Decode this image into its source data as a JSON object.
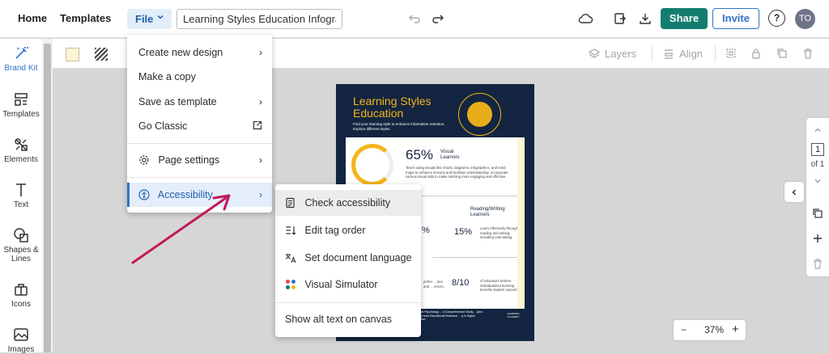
{
  "header": {
    "home": "Home",
    "templates": "Templates",
    "file": "File",
    "document_title": "Learning Styles Education Infogra...",
    "share": "Share",
    "invite": "Invite",
    "help": "?",
    "avatar_initials": "TO"
  },
  "toolbar": {
    "layers": "Layers",
    "align": "Align"
  },
  "sidebar": {
    "items": [
      {
        "label": "Brand Kit",
        "icon": "wand-icon"
      },
      {
        "label": "Templates",
        "icon": "templates-icon"
      },
      {
        "label": "Elements",
        "icon": "elements-icon"
      },
      {
        "label": "Text",
        "icon": "text-icon"
      },
      {
        "label": "Shapes & Lines",
        "icon": "shapes-icon"
      },
      {
        "label": "Icons",
        "icon": "icons-icon"
      },
      {
        "label": "Images",
        "icon": "images-icon"
      }
    ]
  },
  "file_menu": {
    "items": [
      {
        "label": "Create new design",
        "has_submenu": true
      },
      {
        "label": "Make a copy",
        "has_submenu": false
      },
      {
        "label": "Save as template",
        "has_submenu": true
      },
      {
        "label": "Go Classic",
        "has_submenu": false
      },
      {
        "label": "Page settings",
        "has_submenu": true
      },
      {
        "label": "Accessibility",
        "has_submenu": true
      }
    ]
  },
  "accessibility_menu": {
    "items": [
      {
        "label": "Check accessibility",
        "icon": "checklist-icon"
      },
      {
        "label": "Edit tag order",
        "icon": "tag-order-icon"
      },
      {
        "label": "Set document language",
        "icon": "translate-icon"
      },
      {
        "label": "Visual Simulator",
        "icon": "dots-icon"
      },
      {
        "label": "Show alt text on canvas",
        "icon": ""
      }
    ]
  },
  "pages": {
    "current": "1",
    "total_label": "of 1"
  },
  "zoom": {
    "minus": "−",
    "value": "37%",
    "plus": "+"
  },
  "document": {
    "title": "Learning Styles Education",
    "subtitle": "Find your learning style to enhance information retention. Explore different styles.",
    "stat1_value": "65%",
    "stat1_label": "Visual Learners",
    "stat1_text": "Teach using visuals like charts, diagrams, infographics, and mind maps to enhance lessons and facilitate understanding. Incorporate various visual aids to make learning more engaging and effective.",
    "stat2_value": "%",
    "stat3_value": "15%",
    "stat3_label": "Reading/Writing Learners",
    "stat3_text": "Learn effectively through reading and writing, including note-taking.",
    "stat4_prefix_text": "prefer ... tles and ... ences.",
    "stat5_value": "8/10",
    "stat5_text": "of educators believe individualized learning benefits student outcomes.",
    "footer_text": "...ational Psychology ... A Comprehensive Study ... gies: Insights from Educational Research ... g in Higher Education",
    "logo_text": "LEARNING ACADEMY"
  },
  "colors": {
    "doc_navy": "#132540",
    "doc_gold": "#f4b51a",
    "accent_blue": "#2f73c9",
    "share_green": "#137d6f",
    "annotation_arrow": "#c2185b"
  }
}
